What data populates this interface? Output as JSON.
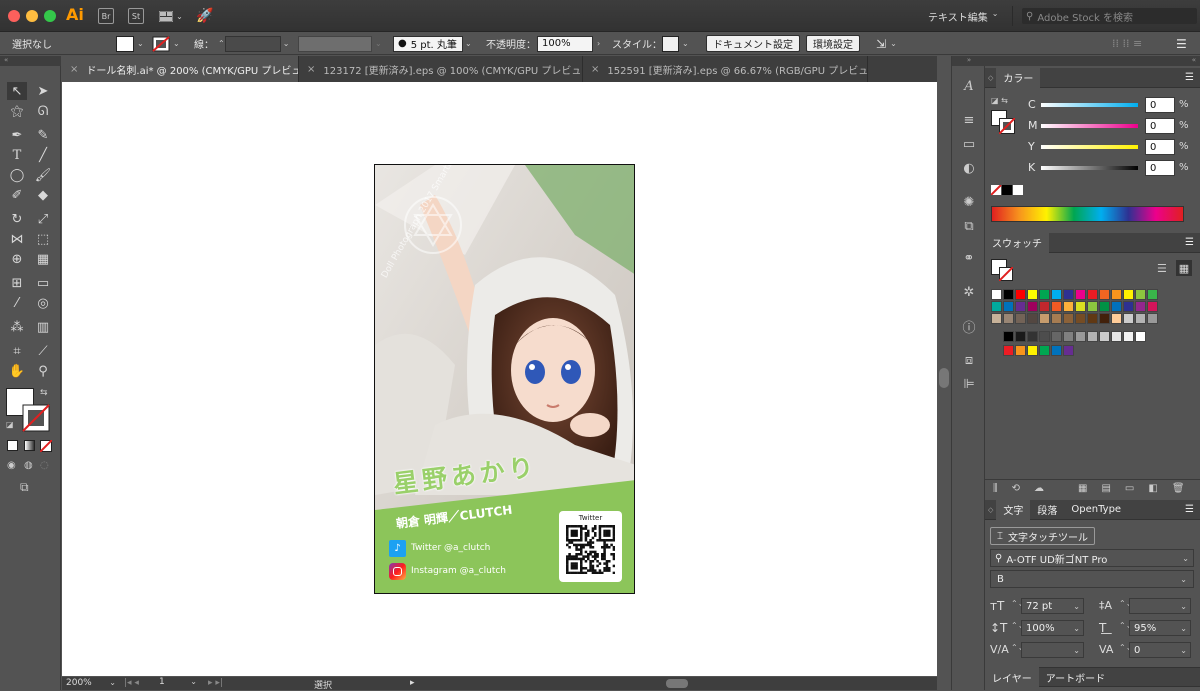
{
  "titlebar": {
    "app_logo": "Ai",
    "bridge": "Br",
    "stock": "St",
    "workspace": "テキスト編集",
    "search_placeholder": "Adobe Stock を検索"
  },
  "control": {
    "selection": "選択なし",
    "stroke_label": "線：",
    "brush": "5 pt. 丸筆",
    "opacity_label": "不透明度：",
    "opacity": "100%",
    "style_label": "スタイル：",
    "doc_setup": "ドキュメント設定",
    "prefs": "環境設定"
  },
  "tabs": [
    {
      "label": "ドール名刺.ai* @ 200% (CMYK/GPU プレビュー)"
    },
    {
      "label": "123172 [更新済み].eps @ 100% (CMYK/GPU プレビュー)"
    },
    {
      "label": "152591 [更新済み].eps @ 66.67% (RGB/GPU プレビュー)"
    }
  ],
  "card": {
    "watermark": "Doll Photograph 2017 SmartDoll 2017",
    "name": "星野あかり",
    "credit": "朝倉 明輝／CLUTCH",
    "twitter": "Twitter @a_clutch",
    "instagram": "Instagram @a_clutch",
    "qr_label": "Twitter"
  },
  "status": {
    "zoom": "200%",
    "page": "1",
    "tool": "選択"
  },
  "color_panel": {
    "title": "カラー",
    "channels": [
      {
        "label": "C",
        "value": "0",
        "unit": "%"
      },
      {
        "label": "M",
        "value": "0",
        "unit": "%"
      },
      {
        "label": "Y",
        "value": "0",
        "unit": "%"
      },
      {
        "label": "K",
        "value": "0",
        "unit": "%"
      }
    ]
  },
  "swatches_panel": {
    "title": "スウォッチ",
    "row1": [
      "#ffffff",
      "#000000",
      "#ff0000",
      "#ffff00",
      "#00a651",
      "#00aeef",
      "#2e3192",
      "#ec008c",
      "#ed1c24",
      "#f26522",
      "#f7941d",
      "#fff200",
      "#8dc63f",
      "#39b54a"
    ],
    "row2": [
      "#00a99d",
      "#0072bc",
      "#662d91",
      "#9e005d",
      "#c1272d",
      "#f15a24",
      "#fbb03b",
      "#d9e021",
      "#8cc63f",
      "#009245",
      "#0071bc",
      "#2e3192",
      "#93278f",
      "#d4145a"
    ],
    "row3": [
      "#c7b299",
      "#998675",
      "#736357",
      "#534741",
      "#c69c6d",
      "#a67c52",
      "#8c6239",
      "#754c24",
      "#603813",
      "#42210b",
      "#ffcc99",
      "#cccccc",
      "#b3b3b3",
      "#999999"
    ],
    "gray_row": [
      "#000000",
      "#1a1a1a",
      "#333333",
      "#4d4d4d",
      "#666666",
      "#808080",
      "#999999",
      "#b3b3b3",
      "#cccccc",
      "#e6e6e6",
      "#f2f2f2",
      "#ffffff"
    ],
    "color_row": [
      "#ed1c24",
      "#f7941d",
      "#fff200",
      "#00a651",
      "#0072bc",
      "#662d91"
    ]
  },
  "char_panel": {
    "tabs": [
      "文字",
      "段落",
      "OpenType"
    ],
    "touch_tool": "文字タッチツール",
    "font": "A-OTF UD新ゴNT Pro",
    "style": "B",
    "size": "72 pt",
    "vscale": "100%",
    "hscale": "95%",
    "tracking": "0"
  },
  "bottom_tabs": [
    "レイヤー",
    "アートボード"
  ]
}
